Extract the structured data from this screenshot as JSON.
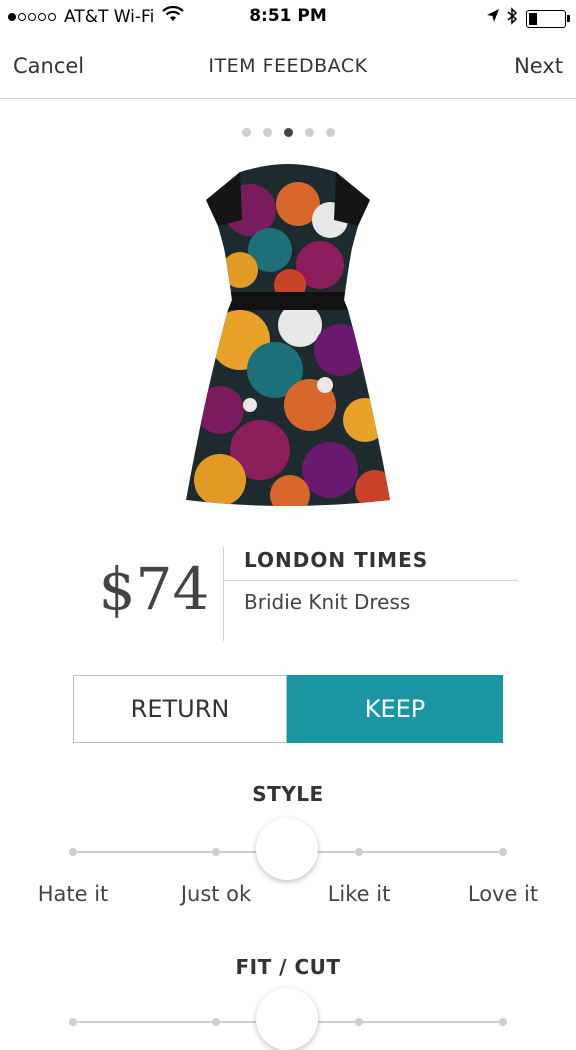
{
  "status_bar": {
    "carrier": "AT&T Wi-Fi",
    "time": "8:51 PM",
    "signal_bars_filled": 1,
    "signal_bars_total": 5,
    "battery_level": 0.25
  },
  "nav": {
    "cancel_label": "Cancel",
    "title": "ITEM FEEDBACK",
    "next_label": "Next"
  },
  "pager": {
    "count": 5,
    "active_index": 2
  },
  "product": {
    "price": "$74",
    "brand": "LONDON TIMES",
    "name": "Bridie Knit Dress",
    "image_icon": "floral-dress-image"
  },
  "decision": {
    "return_label": "RETURN",
    "keep_label": "KEEP",
    "selected": "KEEP",
    "accent_color": "#1a96a2"
  },
  "style_rating": {
    "title": "STYLE",
    "options": [
      "Hate it",
      "Just ok",
      "Like it",
      "Love it"
    ],
    "value": 1.5
  },
  "fit_rating": {
    "title": "FIT / CUT"
  }
}
